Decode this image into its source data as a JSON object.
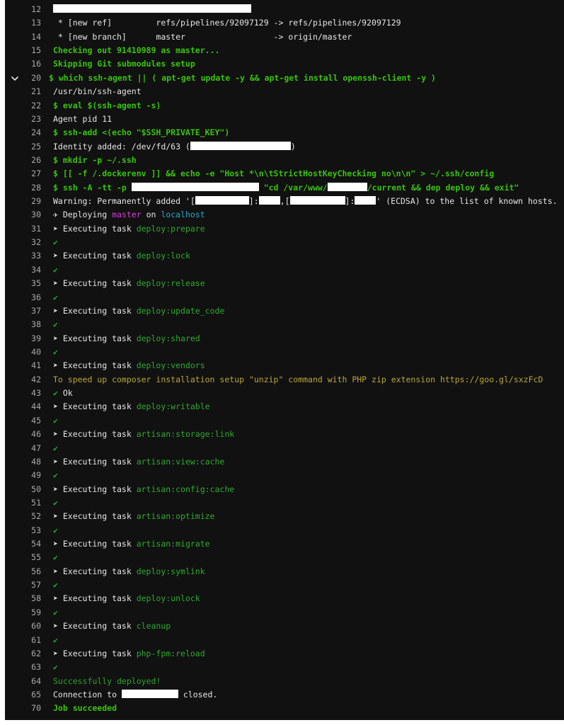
{
  "job_log": {
    "lines": [
      {
        "n": "12",
        "segs": [
          {
            "t": "",
            "c": "wh",
            "r": 280
          }
        ]
      },
      {
        "n": "13",
        "segs": [
          {
            "t": " * [new ref]         refs/pipelines/92097129 -> refs/pipelines/92097129",
            "c": "wh"
          }
        ]
      },
      {
        "n": "14",
        "segs": [
          {
            "t": " * [new branch]      master                  -> origin/master",
            "c": "wh"
          }
        ]
      },
      {
        "n": "15",
        "segs": [
          {
            "t": "Checking out 91410989 as master...",
            "c": "g"
          }
        ]
      },
      {
        "n": "16",
        "segs": [
          {
            "t": "Skipping Git submodules setup",
            "c": "g"
          }
        ]
      },
      {
        "n": "20",
        "chevron": true,
        "segs": [
          {
            "t": "$ which ssh-agent || ( apt-get update -y && apt-get install openssh-client -y )",
            "c": "g"
          }
        ]
      },
      {
        "n": "21",
        "segs": [
          {
            "t": "/usr/bin/ssh-agent",
            "c": "wh"
          }
        ]
      },
      {
        "n": "22",
        "segs": [
          {
            "t": "$ eval $(ssh-agent -s)",
            "c": "g"
          }
        ]
      },
      {
        "n": "23",
        "segs": [
          {
            "t": "Agent pid 11",
            "c": "wh"
          }
        ]
      },
      {
        "n": "24",
        "segs": [
          {
            "t": "$ ssh-add <(echo \"$SSH_PRIVATE_KEY\")",
            "c": "g"
          }
        ]
      },
      {
        "n": "25",
        "segs": [
          {
            "t": "Identity added: /dev/fd/63 (",
            "c": "wh"
          },
          {
            "t": "",
            "c": "wh",
            "r": 142
          },
          {
            "t": ")",
            "c": "wh"
          }
        ]
      },
      {
        "n": "26",
        "segs": [
          {
            "t": "$ mkdir -p ~/.ssh",
            "c": "g"
          }
        ]
      },
      {
        "n": "27",
        "segs": [
          {
            "t": "$ [[ -f /.dockerenv ]] && echo -e \"Host *\\n\\tStrictHostKeyChecking no\\n\\n\" > ~/.ssh/config",
            "c": "g"
          }
        ]
      },
      {
        "n": "28",
        "segs": [
          {
            "t": "$ ssh -A -tt -p ",
            "c": "g"
          },
          {
            "t": "",
            "c": "g",
            "r": 180
          },
          {
            "t": " \"cd /var/www/",
            "c": "g"
          },
          {
            "t": "",
            "c": "g",
            "r": 56
          },
          {
            "t": "/current && dep deploy && exit\"",
            "c": "g"
          }
        ]
      },
      {
        "n": "29",
        "segs": [
          {
            "t": "Warning: Permanently added '[",
            "c": "wh"
          },
          {
            "t": "",
            "c": "wh",
            "r": 76
          },
          {
            "t": "]:",
            "c": "wh"
          },
          {
            "t": "",
            "c": "wh",
            "r": 30
          },
          {
            "t": ",[",
            "c": "wh"
          },
          {
            "t": "",
            "c": "wh",
            "r": 78
          },
          {
            "t": "]:",
            "c": "wh"
          },
          {
            "t": "",
            "c": "wh",
            "r": 30
          },
          {
            "t": "' (ECDSA) to the list of known hosts.",
            "c": "wh"
          }
        ]
      },
      {
        "n": "30",
        "segs": [
          {
            "t": "✈ Deploying ",
            "c": "wh"
          },
          {
            "t": "master",
            "c": "mg"
          },
          {
            "t": " on ",
            "c": "wh"
          },
          {
            "t": "localhost",
            "c": "cy"
          }
        ]
      },
      {
        "n": "31",
        "segs": [
          {
            "t": "➤ Executing task ",
            "c": "wh"
          },
          {
            "t": "deploy:prepare",
            "c": "dg"
          }
        ]
      },
      {
        "n": "32",
        "segs": [
          {
            "t": "✔",
            "c": "gr"
          }
        ]
      },
      {
        "n": "33",
        "segs": [
          {
            "t": "➤ Executing task ",
            "c": "wh"
          },
          {
            "t": "deploy:lock",
            "c": "dg"
          }
        ]
      },
      {
        "n": "34",
        "segs": [
          {
            "t": "✔",
            "c": "gr"
          }
        ]
      },
      {
        "n": "35",
        "segs": [
          {
            "t": "➤ Executing task ",
            "c": "wh"
          },
          {
            "t": "deploy:release",
            "c": "dg"
          }
        ]
      },
      {
        "n": "36",
        "segs": [
          {
            "t": "✔",
            "c": "gr"
          }
        ]
      },
      {
        "n": "37",
        "segs": [
          {
            "t": "➤ Executing task ",
            "c": "wh"
          },
          {
            "t": "deploy:update_code",
            "c": "dg"
          }
        ]
      },
      {
        "n": "38",
        "segs": [
          {
            "t": "✔",
            "c": "gr"
          }
        ]
      },
      {
        "n": "39",
        "segs": [
          {
            "t": "➤ Executing task ",
            "c": "wh"
          },
          {
            "t": "deploy:shared",
            "c": "dg"
          }
        ]
      },
      {
        "n": "40",
        "segs": [
          {
            "t": "✔",
            "c": "gr"
          }
        ]
      },
      {
        "n": "41",
        "segs": [
          {
            "t": "➤ Executing task ",
            "c": "wh"
          },
          {
            "t": "deploy:vendors",
            "c": "dg"
          }
        ]
      },
      {
        "n": "42",
        "segs": [
          {
            "t": "To speed up composer installation setup \"unzip\" command with PHP zip extension https://goo.gl/sxzFcD",
            "c": "yl"
          }
        ]
      },
      {
        "n": "43",
        "segs": [
          {
            "t": "✔ ",
            "c": "gr"
          },
          {
            "t": "Ok",
            "c": "wh"
          }
        ]
      },
      {
        "n": "44",
        "segs": [
          {
            "t": "➤ Executing task ",
            "c": "wh"
          },
          {
            "t": "deploy:writable",
            "c": "dg"
          }
        ]
      },
      {
        "n": "45",
        "segs": [
          {
            "t": "✔",
            "c": "gr"
          }
        ]
      },
      {
        "n": "46",
        "segs": [
          {
            "t": "➤ Executing task ",
            "c": "wh"
          },
          {
            "t": "artisan:storage:link",
            "c": "dg"
          }
        ]
      },
      {
        "n": "47",
        "segs": [
          {
            "t": "✔",
            "c": "gr"
          }
        ]
      },
      {
        "n": "48",
        "segs": [
          {
            "t": "➤ Executing task ",
            "c": "wh"
          },
          {
            "t": "artisan:view:cache",
            "c": "dg"
          }
        ]
      },
      {
        "n": "49",
        "segs": [
          {
            "t": "✔",
            "c": "gr"
          }
        ]
      },
      {
        "n": "50",
        "segs": [
          {
            "t": "➤ Executing task ",
            "c": "wh"
          },
          {
            "t": "artisan:config:cache",
            "c": "dg"
          }
        ]
      },
      {
        "n": "51",
        "segs": [
          {
            "t": "✔",
            "c": "gr"
          }
        ]
      },
      {
        "n": "52",
        "segs": [
          {
            "t": "➤ Executing task ",
            "c": "wh"
          },
          {
            "t": "artisan:optimize",
            "c": "dg"
          }
        ]
      },
      {
        "n": "53",
        "segs": [
          {
            "t": "✔",
            "c": "gr"
          }
        ]
      },
      {
        "n": "54",
        "segs": [
          {
            "t": "➤ Executing task ",
            "c": "wh"
          },
          {
            "t": "artisan:migrate",
            "c": "dg"
          }
        ]
      },
      {
        "n": "55",
        "segs": [
          {
            "t": "✔",
            "c": "gr"
          }
        ]
      },
      {
        "n": "56",
        "segs": [
          {
            "t": "➤ Executing task ",
            "c": "wh"
          },
          {
            "t": "deploy:symlink",
            "c": "dg"
          }
        ]
      },
      {
        "n": "57",
        "segs": [
          {
            "t": "✔",
            "c": "gr"
          }
        ]
      },
      {
        "n": "58",
        "segs": [
          {
            "t": "➤ Executing task ",
            "c": "wh"
          },
          {
            "t": "deploy:unlock",
            "c": "dg"
          }
        ]
      },
      {
        "n": "59",
        "segs": [
          {
            "t": "✔",
            "c": "gr"
          }
        ]
      },
      {
        "n": "60",
        "segs": [
          {
            "t": "➤ Executing task ",
            "c": "wh"
          },
          {
            "t": "cleanup",
            "c": "dg"
          }
        ]
      },
      {
        "n": "61",
        "segs": [
          {
            "t": "✔",
            "c": "gr"
          }
        ]
      },
      {
        "n": "62",
        "segs": [
          {
            "t": "➤ Executing task ",
            "c": "wh"
          },
          {
            "t": "php-fpm:reload",
            "c": "dg"
          }
        ]
      },
      {
        "n": "63",
        "segs": [
          {
            "t": "✔",
            "c": "gr"
          }
        ]
      },
      {
        "n": "64",
        "segs": [
          {
            "t": "Successfully deployed!",
            "c": "gr"
          }
        ]
      },
      {
        "n": "65",
        "segs": [
          {
            "t": "Connection to ",
            "c": "wh"
          },
          {
            "t": "",
            "c": "wh",
            "r": 80
          },
          {
            "t": " closed.",
            "c": "wh"
          }
        ]
      },
      {
        "n": "70",
        "segs": [
          {
            "t": "Job succeeded",
            "c": "g"
          }
        ]
      }
    ]
  }
}
